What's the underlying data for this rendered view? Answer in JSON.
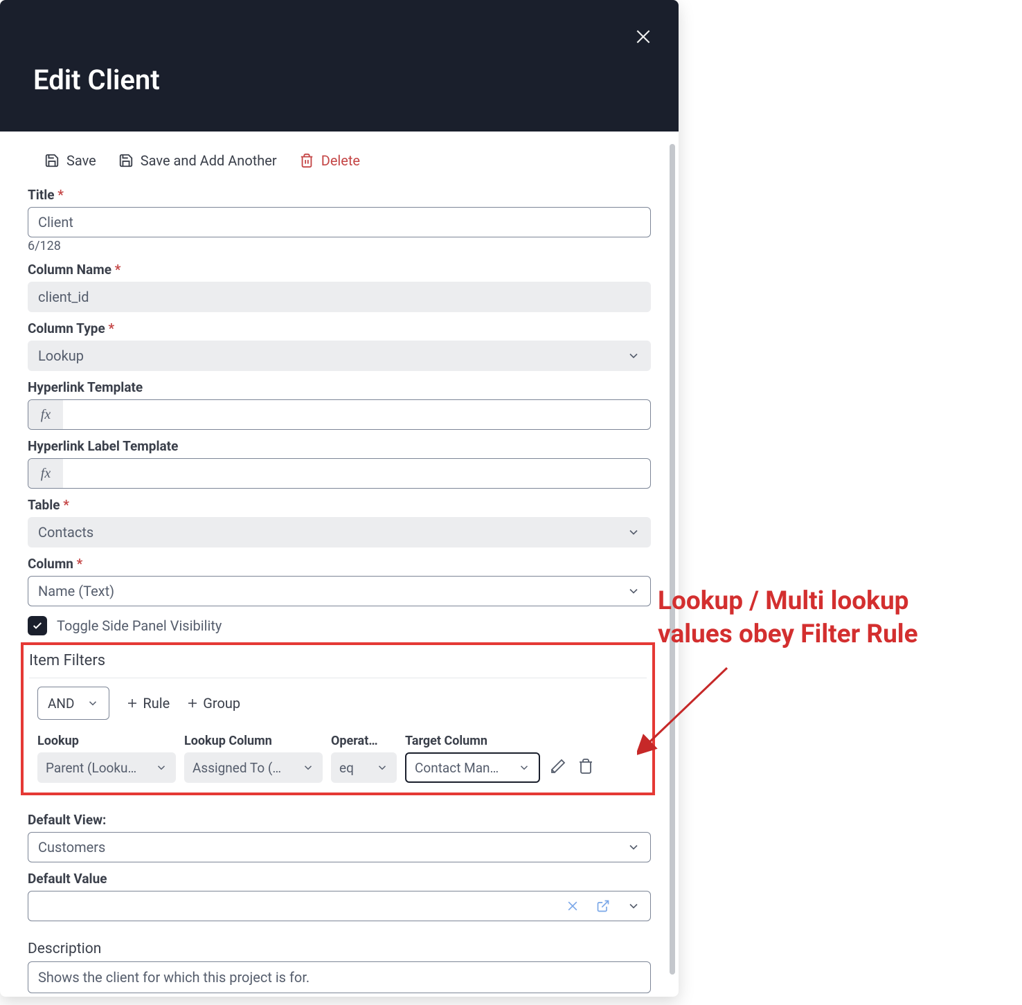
{
  "header": {
    "title": "Edit Client"
  },
  "toolbar": {
    "save_label": "Save",
    "save_add_label": "Save and Add Another",
    "delete_label": "Delete"
  },
  "fields": {
    "title_label": "Title",
    "title_value": "Client",
    "title_counter": "6/128",
    "column_name_label": "Column Name",
    "column_name_value": "client_id",
    "column_type_label": "Column Type",
    "column_type_value": "Lookup",
    "hyperlink_template_label": "Hyperlink Template",
    "hyperlink_template_value": "",
    "hyperlink_label_template_label": "Hyperlink Label Template",
    "hyperlink_label_template_value": "",
    "table_label": "Table",
    "table_value": "Contacts",
    "column_label": "Column",
    "column_value": "Name (Text)",
    "toggle_label": "Toggle Side Panel Visibility",
    "toggle_checked": true,
    "default_view_label": "Default View:",
    "default_view_value": "Customers",
    "default_value_label": "Default Value",
    "default_value_value": "",
    "description_label": "Description",
    "description_value": "Shows the client for which this project is for."
  },
  "filters": {
    "section_label": "Item Filters",
    "conjunction": "AND",
    "rule_btn": "Rule",
    "group_btn": "Group",
    "columns": {
      "lookup_hdr": "Lookup",
      "lookup_col_hdr": "Lookup Column",
      "operator_hdr": "Operat…",
      "target_col_hdr": "Target Column"
    },
    "rule": {
      "lookup": "Parent (Looku…",
      "lookup_column": "Assigned To (…",
      "operator": "eq",
      "target_column": "Contact Man…"
    }
  },
  "fx_prefix": "fx",
  "annotation": {
    "line1": "Lookup / Multi lookup",
    "line2": "values obey Filter Rule"
  }
}
